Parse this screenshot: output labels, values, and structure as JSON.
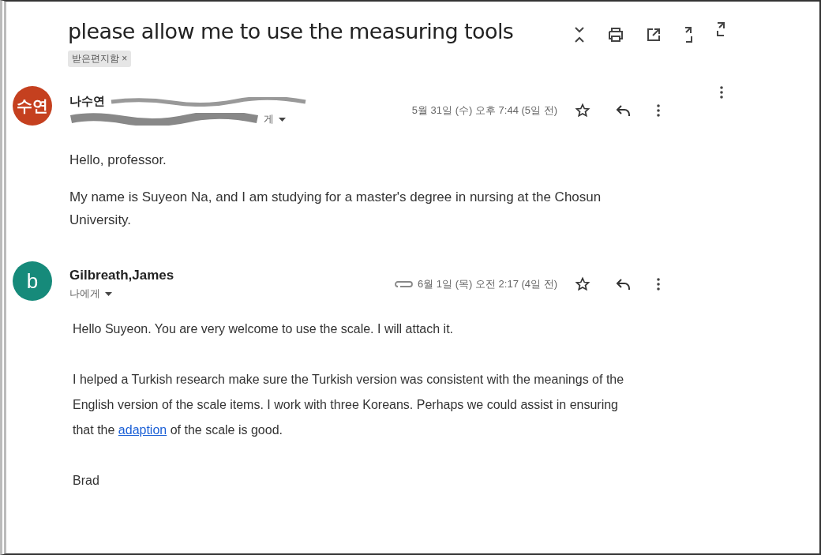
{
  "subject": "please allow me to use the measuring tools",
  "label": {
    "text": "받은편지함",
    "close": "×"
  },
  "messages": [
    {
      "avatar": "수연",
      "color": "#c5401f",
      "sender": "나수연",
      "sender_bold": false,
      "redacted": true,
      "recipient_tail": "게",
      "has_attachment": false,
      "date": "5월 31일 (수) 오후 7:44 (5일 전)",
      "kind": "plain",
      "paragraphs": [
        [
          {
            "text": "Hello, professor."
          }
        ],
        [
          {
            "text": "My name is Suyeon Na, and I am studying for a master's degree in nursing at the Chosun University."
          }
        ]
      ]
    },
    {
      "avatar": "b",
      "color": "#168a7a",
      "sender": "Gilbreath,James",
      "sender_bold": true,
      "redacted": false,
      "recipient_tail": "나에게",
      "has_attachment": true,
      "date": "6월 1일 (목) 오전 2:17 (4일 전)",
      "kind": "wide",
      "paragraphs": [
        [
          {
            "text": "Hello Suyeon. You are very welcome to use the scale. I will attach it."
          }
        ],
        [
          {
            "text": "I helped a Turkish research make sure the Turkish version was consistent with the meanings of the English version of the scale items. I work with three Koreans. Perhaps we could assist in ensuring that the "
          },
          {
            "text": "adaption",
            "kind": "link"
          },
          {
            "text": " of the scale is good."
          }
        ],
        [
          {
            "text": "Brad"
          }
        ]
      ]
    }
  ]
}
